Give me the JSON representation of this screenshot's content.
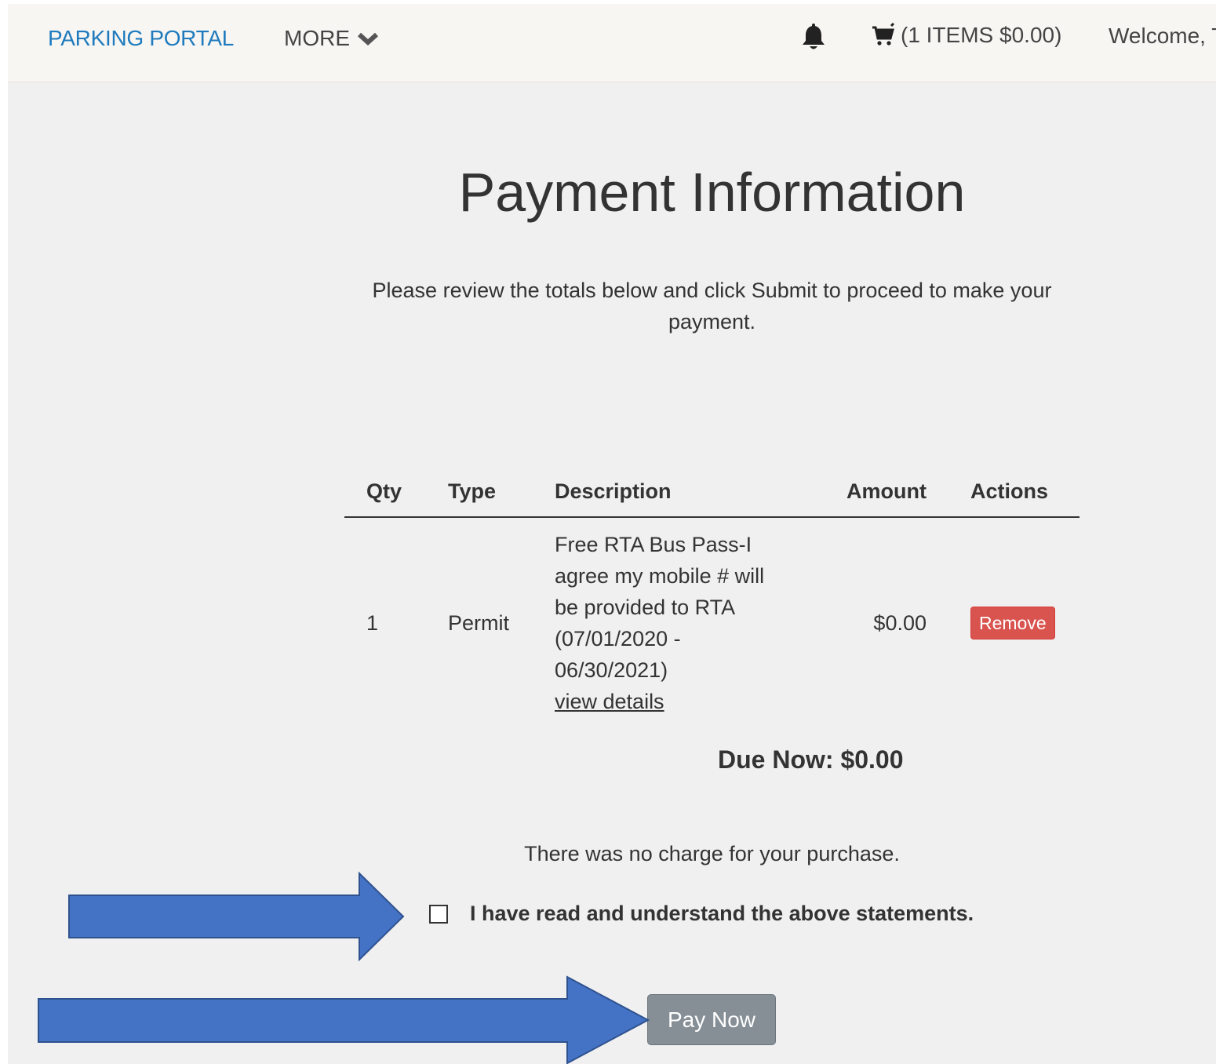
{
  "navbar": {
    "brand": "PARKING PORTAL",
    "more_label": "MORE",
    "cart_label": "(1 ITEMS $0.00)",
    "welcome_text": "Welcome, T"
  },
  "page": {
    "title": "Payment Information",
    "intro": "Please review the totals below and click Submit to proceed to make your payment."
  },
  "table": {
    "headers": {
      "qty": "Qty",
      "type": "Type",
      "description": "Description",
      "amount": "Amount",
      "actions": "Actions"
    },
    "rows": [
      {
        "qty": "1",
        "type": "Permit",
        "description": "Free RTA Bus Pass-I agree my mobile # will be provided to RTA (07/01/2020 - 06/30/2021)",
        "details_link": "view details",
        "amount": "$0.00",
        "action_label": "Remove"
      }
    ]
  },
  "due_now": "Due Now: $0.00",
  "no_charge_message": "There was no charge for your purchase.",
  "acknowledgement": {
    "label": "I have read and understand the above statements.",
    "checked": false
  },
  "pay_button_label": "Pay Now",
  "colors": {
    "brand": "#1f7bbd",
    "remove": "#d9534f",
    "pay_button": "#868e96",
    "annotation_arrow": "#4472c4"
  }
}
